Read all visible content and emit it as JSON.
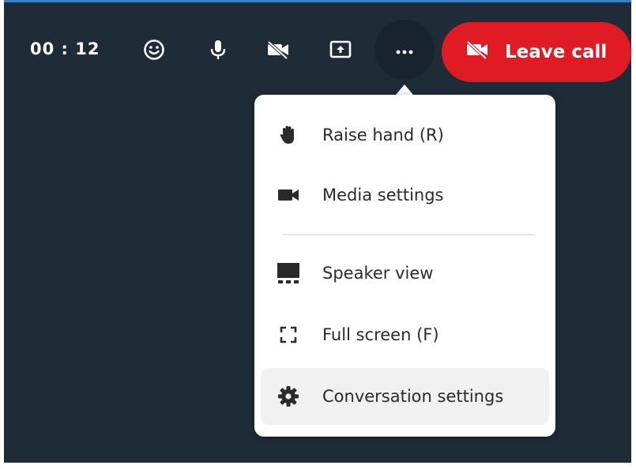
{
  "toolbar": {
    "timer": "00 : 12",
    "leave_label": "Leave call",
    "icons": {
      "emoji": "smiley-icon",
      "mic": "microphone-icon",
      "camera": "camera-off-icon",
      "share": "screen-share-icon",
      "more": "more-horizontal-icon",
      "leave": "camera-off-icon"
    }
  },
  "menu": {
    "items": [
      {
        "label": "Raise hand (R)",
        "icon": "hand-icon"
      },
      {
        "label": "Media settings",
        "icon": "video-camera-icon"
      },
      {
        "label": "Speaker view",
        "icon": "speaker-view-icon"
      },
      {
        "label": "Full screen (F)",
        "icon": "fullscreen-icon"
      },
      {
        "label": "Conversation settings",
        "icon": "gear-icon"
      }
    ]
  },
  "colors": {
    "background": "#1f2c38",
    "leave_button": "#e01b24",
    "menu_background": "#ffffff",
    "highlight": "#f1f1f1",
    "top_border": "#3b7fc4"
  }
}
